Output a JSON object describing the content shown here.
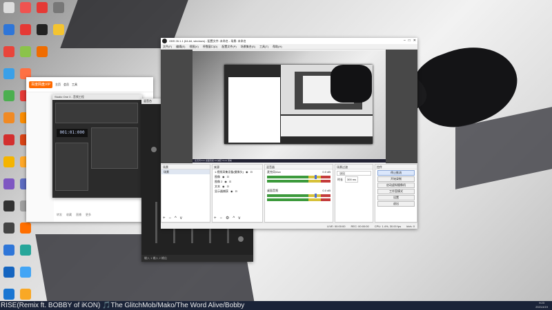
{
  "desktop": {
    "col1": [
      "",
      "",
      "",
      "",
      "",
      "",
      "",
      "",
      "",
      "",
      "",
      "",
      "",
      ""
    ],
    "col2": [
      "",
      "",
      "",
      "",
      "",
      "",
      "",
      "",
      "",
      "",
      "",
      "",
      "",
      ""
    ],
    "col3": [
      "",
      "",
      ""
    ]
  },
  "chat": {
    "logo": "百度网盘VIP",
    "nav": [
      "主页",
      "会员",
      "工具"
    ],
    "footer": [
      "转发",
      "收藏",
      "直播",
      "更多"
    ]
  },
  "daw": {
    "title": "Studio One 3 - 音频工程",
    "time": "001:01:000"
  },
  "mixer": {
    "title": "混音台",
    "strip_label": "输入 1    输入 2    输出"
  },
  "obs": {
    "title": "OBS 26.1.1 (64-bit, windows) - 配置文件: 未命名 - 场景: 未命名",
    "menu": [
      "文件(F)",
      "编辑(E)",
      "视图(V)",
      "停靠窗口(D)",
      "配置文件(P)",
      "场景集合(S)",
      "工具(T)",
      "帮助(H)"
    ],
    "preview_status": "麦克风/Aux  桌面音频  A2  捕获  Tools  录制",
    "docks": {
      "scenes": {
        "header": "场景",
        "items": [
          "场景"
        ]
      },
      "sources": {
        "header": "来源",
        "items": [
          "1.视频采集设备(摄像头)",
          "图像",
          "图像 2",
          "文本",
          "显示器捕获"
        ]
      },
      "mixer": {
        "header": "混音器",
        "channels": [
          {
            "name": "麦克风/Aux",
            "db": "0.0 dB"
          },
          {
            "name": "桌面音频",
            "db": "0.0 dB"
          }
        ]
      },
      "transitions": {
        "header": "场景过渡",
        "type": "淡出",
        "duration_label": "时长",
        "duration": "300 ms"
      },
      "controls": {
        "header": "控件",
        "buttons": [
          "停止推流",
          "开始录制",
          "启动虚拟摄像机",
          "工作室模式",
          "设置",
          "退出"
        ]
      }
    },
    "status": {
      "live": "LIVE: 00:00:00",
      "rec": "REC: 00:00:00",
      "cpu": "CPU: 1.4%, 30.00 fps",
      "kb": "kb/s: 0"
    }
  },
  "taskbar": {
    "ticker": "RISE(Remix ft. BOBBY of iKON) 🎵The GlitchMob/Mako/The Word Alive/Bobby",
    "time": "9:23",
    "date": "2021/4/19"
  }
}
